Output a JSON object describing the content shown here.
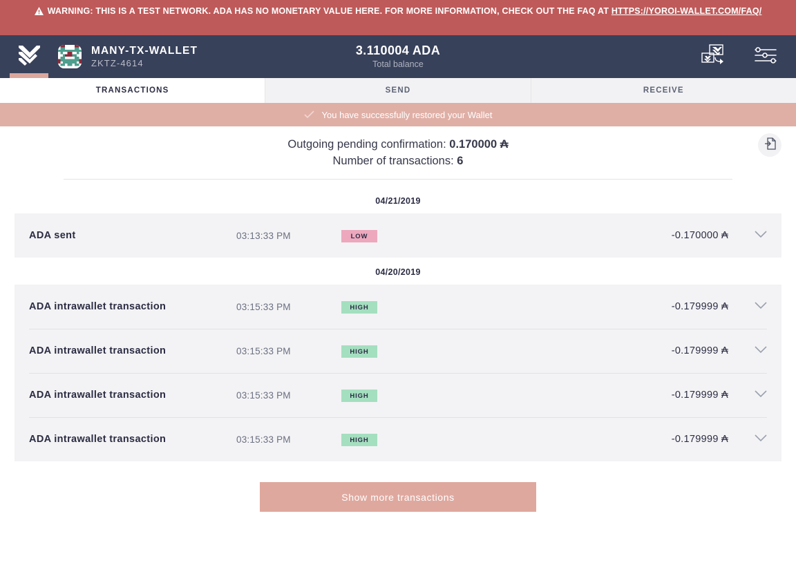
{
  "warning": {
    "icon": "warning-triangle-icon",
    "text": "WARNING: THIS IS A TEST NETWORK. ADA HAS NO MONETARY VALUE HERE. FOR MORE INFORMATION, CHECK OUT THE FAQ AT ",
    "link_text": "HTTPS://YOROI-WALLET.COM/FAQ/",
    "bg_color": "#bf5a5a"
  },
  "topbar": {
    "logo": "yoroi-logo-icon",
    "wallet_name": "MANY-TX-WALLET",
    "wallet_plate": "ZKTZ-4614",
    "balance_amount": "3.110004 ADA",
    "balance_label": "Total balance",
    "actions": [
      {
        "name": "switch-wallet-icon"
      },
      {
        "name": "settings-sliders-icon"
      }
    ],
    "bg_color": "#38415a",
    "accent_color": "#dba79c"
  },
  "tabs": [
    {
      "label": "TRANSACTIONS",
      "active": true
    },
    {
      "label": "SEND",
      "active": false
    },
    {
      "label": "RECEIVE",
      "active": false
    }
  ],
  "notification": {
    "icon": "check-icon",
    "message": "You have successfully restored your Wallet",
    "bg_color": "#dfafa6"
  },
  "summary": {
    "pending_label": "Outgoing pending confirmation:",
    "pending_value": "0.170000 ₳",
    "count_label": "Number of transactions:",
    "count_value": "6",
    "export_icon": "export-file-icon"
  },
  "transaction_groups": [
    {
      "date": "04/21/2019",
      "rows": [
        {
          "title": "ADA sent",
          "time": "03:13:33 PM",
          "badge": "LOW",
          "badge_type": "low",
          "amount": "-0.170000 ₳"
        }
      ]
    },
    {
      "date": "04/20/2019",
      "rows": [
        {
          "title": "ADA intrawallet transaction",
          "time": "03:15:33 PM",
          "badge": "HIGH",
          "badge_type": "high",
          "amount": "-0.179999 ₳"
        },
        {
          "title": "ADA intrawallet transaction",
          "time": "03:15:33 PM",
          "badge": "HIGH",
          "badge_type": "high",
          "amount": "-0.179999 ₳"
        },
        {
          "title": "ADA intrawallet transaction",
          "time": "03:15:33 PM",
          "badge": "HIGH",
          "badge_type": "high",
          "amount": "-0.179999 ₳"
        },
        {
          "title": "ADA intrawallet transaction",
          "time": "03:15:33 PM",
          "badge": "HIGH",
          "badge_type": "high",
          "amount": "-0.179999 ₳"
        }
      ]
    }
  ],
  "show_more_label": "Show more transactions",
  "colors": {
    "badge_low": "#eda8bd",
    "badge_high": "#a4dfc0",
    "accent": "#dfa89e",
    "dark": "#38415a"
  }
}
